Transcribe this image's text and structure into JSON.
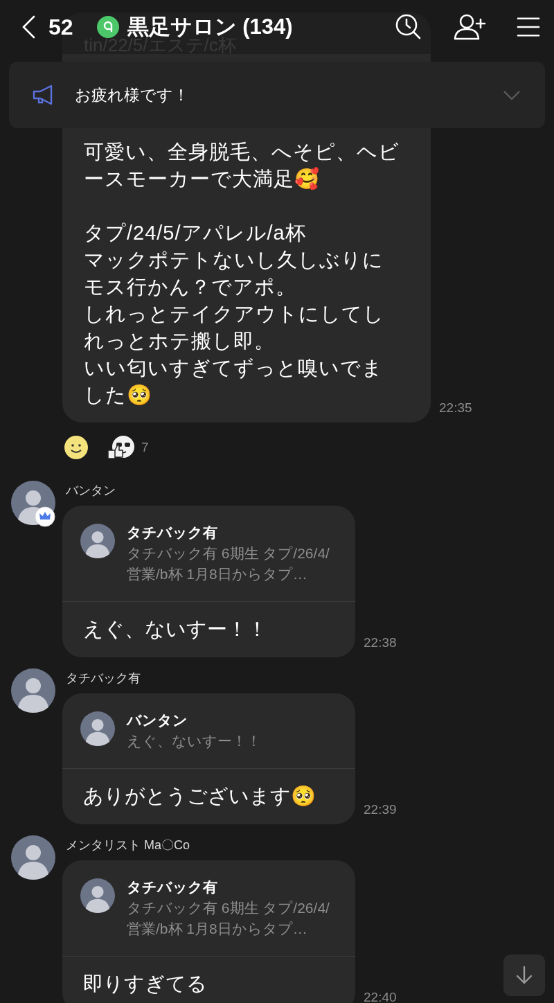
{
  "header": {
    "back_count": "52",
    "title": "黒足サロン (134)"
  },
  "announcement": {
    "text": "お疲れ様です！",
    "expanded": false
  },
  "messages": [
    {
      "kind": "continued",
      "partial_line": "tin/22/5/エステ/c杯",
      "paragraphs": [
        {
          "lines": [
            "可愛い、全身脱毛、へそピ、ヘビースモーカーで大満足🥰"
          ]
        },
        {
          "lines": [
            "タプ/24/5/アパレル/a杯",
            "マックポテトないし久しぶりにモス行かん？でアポ。",
            "しれっとテイクアウトにしてしれっとホテ搬し即。",
            "いい匂いすぎてずっと嗅いでました🥺"
          ]
        }
      ],
      "time": "22:35",
      "reactions": [
        {
          "kind": "smiley"
        },
        {
          "kind": "sticker",
          "count": "7"
        }
      ]
    },
    {
      "kind": "reply",
      "sender": "バンタン",
      "admin": true,
      "quote": {
        "name": "タチバック有",
        "text": "タチバック有 6期生 タプ/26/4/営業/b杯 1月8日からタプ…"
      },
      "paragraphs": [
        {
          "lines": [
            "えぐ、ないすー！！"
          ]
        }
      ],
      "time": "22:38"
    },
    {
      "kind": "reply",
      "sender": "タチバック有",
      "admin": false,
      "quote": {
        "name": "バンタン",
        "text": "えぐ、ないすー！！"
      },
      "paragraphs": [
        {
          "lines": [
            "ありがとうございます🥺"
          ]
        }
      ],
      "time": "22:39"
    },
    {
      "kind": "reply",
      "sender": "メンタリスト Ma〇Co",
      "admin": false,
      "quote": {
        "name": "タチバック有",
        "text": "タチバック有 6期生 タプ/26/4/営業/b杯 1月8日からタプ…"
      },
      "paragraphs": [
        {
          "lines": [
            "即りすぎてる"
          ]
        }
      ],
      "time": "22:40"
    }
  ]
}
